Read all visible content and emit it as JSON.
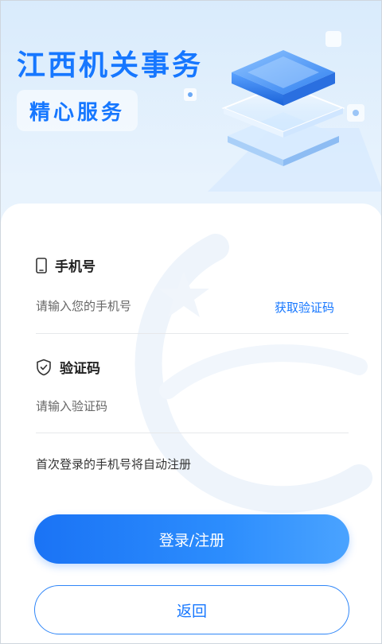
{
  "header": {
    "title": "江西机关事务",
    "slogan": "精心服务"
  },
  "form": {
    "phone": {
      "label": "手机号",
      "icon": "phone-icon",
      "placeholder": "请输入您的手机号",
      "value": "",
      "get_code_label": "获取验证码"
    },
    "code": {
      "label": "验证码",
      "icon": "shield-check-icon",
      "placeholder": "请输入验证码",
      "value": ""
    },
    "notice": "首次登录的手机号将自动注册"
  },
  "actions": {
    "login_label": "登录/注册",
    "back_label": "返回"
  },
  "colors": {
    "accent": "#1677ff",
    "background": "#eaf3fd"
  }
}
